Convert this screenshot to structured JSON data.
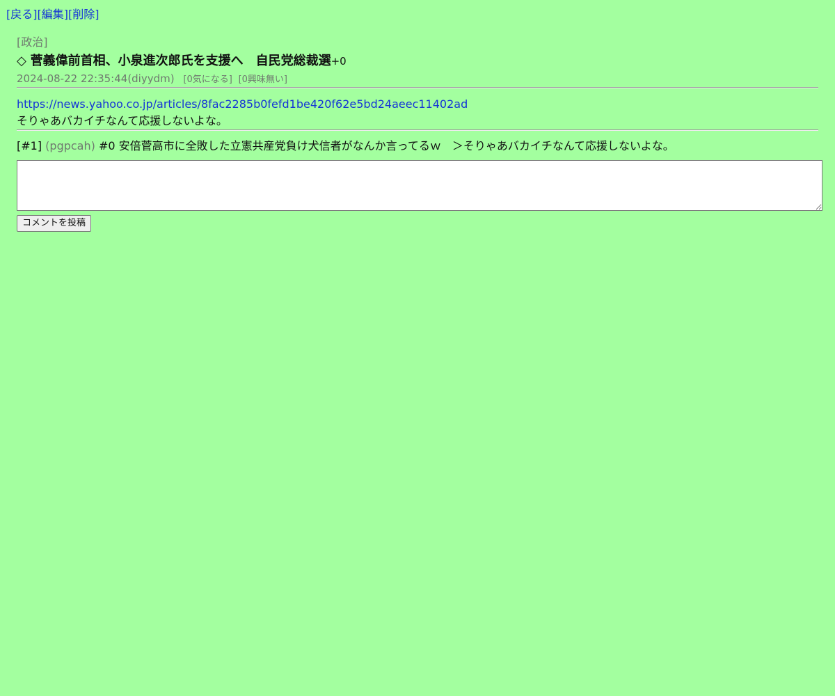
{
  "nav": {
    "back": "[戻る]",
    "edit": "[編集]",
    "delete": "[削除]"
  },
  "post": {
    "category": "[政治]",
    "mark": "◇",
    "title": "菅義偉前首相、小泉進次郎氏を支援へ　自民党総裁選",
    "score": "+0",
    "datetime": "2024-08-22 22:35:44",
    "author": "(diyydm)",
    "interested": "[0気になる]",
    "not_interested": "[0興味無い]",
    "link": "https://news.yahoo.co.jp/articles/8fac2285b0fefd1be420f62e5bd24aeec11402ad",
    "text": "そりゃあバカイチなんて応援しないよな。"
  },
  "comments": [
    {
      "index": "[#1]",
      "author": "(pgpcah)",
      "text": "#0 安倍菅高市に全敗した立憲共産党負け犬信者がなんか言ってるｗ　＞そりゃあバカイチなんて応援しないよな。"
    }
  ],
  "form": {
    "reply_value": "",
    "submit_label": "コメントを投稿"
  },
  "colors": {
    "background": "#a3ff9f",
    "link": "#1434d6",
    "muted": "#6f7a6f"
  }
}
